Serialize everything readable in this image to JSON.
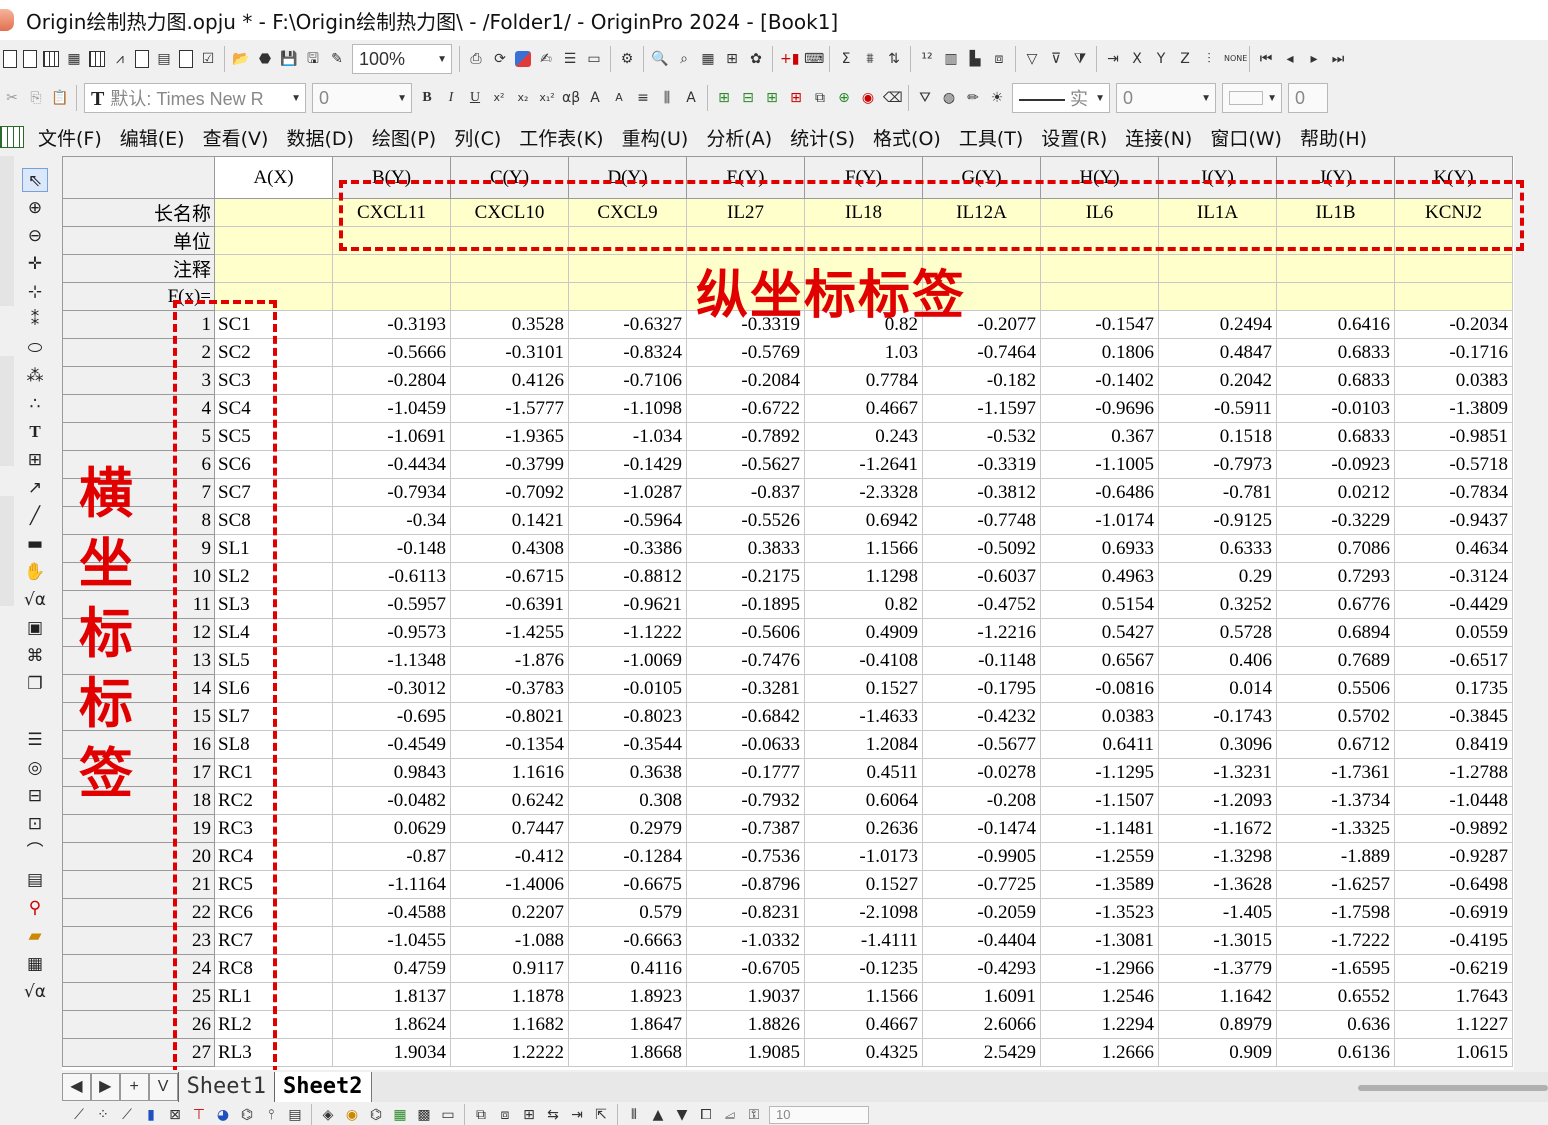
{
  "window": {
    "title": "Origin绘制热力图.opju * - F:\\Origin绘制热力图\\ - /Folder1/ - OriginPro 2024 - [Book1]"
  },
  "toolbar": {
    "zoom_value": "100%",
    "font_name": "默认: Times New R",
    "font_size": "0",
    "line_style": "实",
    "line_width": "0",
    "fill_value": "0",
    "bottom_font_size": "10"
  },
  "menu": {
    "items": [
      "文件(F)",
      "编辑(E)",
      "查看(V)",
      "数据(D)",
      "绘图(P)",
      "列(C)",
      "工作表(K)",
      "重构(U)",
      "分析(A)",
      "统计(S)",
      "格式(O)",
      "工具(T)",
      "设置(R)",
      "连接(N)",
      "窗口(W)",
      "帮助(H)"
    ]
  },
  "worksheet": {
    "columns": [
      "A(X)",
      "B(Y)",
      "C(Y)",
      "D(Y)",
      "E(Y)",
      "F(Y)",
      "G(Y)",
      "H(Y)",
      "I(Y)",
      "J(Y)",
      "K(Y)"
    ],
    "meta_labels": [
      "长名称",
      "单位",
      "注释",
      "F(x)="
    ],
    "long_names": [
      "",
      "CXCL11",
      "CXCL10",
      "CXCL9",
      "IL27",
      "IL18",
      "IL12A",
      "IL6",
      "IL1A",
      "IL1B",
      "KCNJ2"
    ],
    "rows": [
      [
        "1",
        "SC1",
        "-0.3193",
        "0.3528",
        "-0.6327",
        "-0.3319",
        "0.82",
        "-0.2077",
        "-0.1547",
        "0.2494",
        "0.6416",
        "-0.2034"
      ],
      [
        "2",
        "SC2",
        "-0.5666",
        "-0.3101",
        "-0.8324",
        "-0.5769",
        "1.03",
        "-0.7464",
        "0.1806",
        "0.4847",
        "0.6833",
        "-0.1716"
      ],
      [
        "3",
        "SC3",
        "-0.2804",
        "0.4126",
        "-0.7106",
        "-0.2084",
        "0.7784",
        "-0.182",
        "-0.1402",
        "0.2042",
        "0.6833",
        "0.0383"
      ],
      [
        "4",
        "SC4",
        "-1.0459",
        "-1.5777",
        "-1.1098",
        "-0.6722",
        "0.4667",
        "-1.1597",
        "-0.9696",
        "-0.5911",
        "-0.0103",
        "-1.3809"
      ],
      [
        "5",
        "SC5",
        "-1.0691",
        "-1.9365",
        "-1.034",
        "-0.7892",
        "0.243",
        "-0.532",
        "0.367",
        "0.1518",
        "0.6833",
        "-0.9851"
      ],
      [
        "6",
        "SC6",
        "-0.4434",
        "-0.3799",
        "-0.1429",
        "-0.5627",
        "-1.2641",
        "-0.3319",
        "-1.1005",
        "-0.7973",
        "-0.0923",
        "-0.5718"
      ],
      [
        "7",
        "SC7",
        "-0.7934",
        "-0.7092",
        "-1.0287",
        "-0.837",
        "-2.3328",
        "-0.3812",
        "-0.6486",
        "-0.781",
        "0.0212",
        "-0.7834"
      ],
      [
        "8",
        "SC8",
        "-0.34",
        "0.1421",
        "-0.5964",
        "-0.5526",
        "0.6942",
        "-0.7748",
        "-1.0174",
        "-0.9125",
        "-0.3229",
        "-0.9437"
      ],
      [
        "9",
        "SL1",
        "-0.148",
        "0.4308",
        "-0.3386",
        "0.3833",
        "1.1566",
        "-0.5092",
        "0.6933",
        "0.6333",
        "0.7086",
        "0.4634"
      ],
      [
        "10",
        "SL2",
        "-0.6113",
        "-0.6715",
        "-0.8812",
        "-0.2175",
        "1.1298",
        "-0.6037",
        "0.4963",
        "0.29",
        "0.7293",
        "-0.3124"
      ],
      [
        "11",
        "SL3",
        "-0.5957",
        "-0.6391",
        "-0.9621",
        "-0.1895",
        "0.82",
        "-0.4752",
        "0.5154",
        "0.3252",
        "0.6776",
        "-0.4429"
      ],
      [
        "12",
        "SL4",
        "-0.9573",
        "-1.4255",
        "-1.1222",
        "-0.5606",
        "0.4909",
        "-1.2216",
        "0.5427",
        "0.5728",
        "0.6894",
        "0.0559"
      ],
      [
        "13",
        "SL5",
        "-1.1348",
        "-1.876",
        "-1.0069",
        "-0.7476",
        "-0.4108",
        "-0.1148",
        "0.6567",
        "0.406",
        "0.7689",
        "-0.6517"
      ],
      [
        "14",
        "SL6",
        "-0.3012",
        "-0.3783",
        "-0.0105",
        "-0.3281",
        "0.1527",
        "-0.1795",
        "-0.0816",
        "0.014",
        "0.5506",
        "0.1735"
      ],
      [
        "15",
        "SL7",
        "-0.695",
        "-0.8021",
        "-0.8023",
        "-0.6842",
        "-1.4633",
        "-0.4232",
        "0.0383",
        "-0.1743",
        "0.5702",
        "-0.3845"
      ],
      [
        "16",
        "SL8",
        "-0.4549",
        "-0.1354",
        "-0.3544",
        "-0.0633",
        "1.2084",
        "-0.5677",
        "0.6411",
        "0.3096",
        "0.6712",
        "0.8419"
      ],
      [
        "17",
        "RC1",
        "0.9843",
        "1.1616",
        "0.3638",
        "-0.1777",
        "0.4511",
        "-0.0278",
        "-1.1295",
        "-1.3231",
        "-1.7361",
        "-1.2788"
      ],
      [
        "18",
        "RC2",
        "-0.0482",
        "0.6242",
        "0.308",
        "-0.7932",
        "0.6064",
        "-0.208",
        "-1.1507",
        "-1.2093",
        "-1.3734",
        "-1.0448"
      ],
      [
        "19",
        "RC3",
        "0.0629",
        "0.7447",
        "0.2979",
        "-0.7387",
        "0.2636",
        "-0.1474",
        "-1.1481",
        "-1.1672",
        "-1.3325",
        "-0.9892"
      ],
      [
        "20",
        "RC4",
        "-0.87",
        "-0.412",
        "-0.1284",
        "-0.7536",
        "-1.0173",
        "-0.9905",
        "-1.2559",
        "-1.3298",
        "-1.889",
        "-0.9287"
      ],
      [
        "21",
        "RC5",
        "-1.1164",
        "-1.4006",
        "-0.6675",
        "-0.8796",
        "0.1527",
        "-0.7725",
        "-1.3589",
        "-1.3628",
        "-1.6257",
        "-0.6498"
      ],
      [
        "22",
        "RC6",
        "-0.4588",
        "0.2207",
        "0.579",
        "-0.8231",
        "-2.1098",
        "-0.2059",
        "-1.3523",
        "-1.405",
        "-1.7598",
        "-0.6919"
      ],
      [
        "23",
        "RC7",
        "-1.0455",
        "-1.088",
        "-0.6663",
        "-1.0332",
        "-1.4111",
        "-0.4404",
        "-1.3081",
        "-1.3015",
        "-1.7222",
        "-0.4195"
      ],
      [
        "24",
        "RC8",
        "0.4759",
        "0.9117",
        "0.4116",
        "-0.6705",
        "-0.1235",
        "-0.4293",
        "-1.2966",
        "-1.3779",
        "-1.6595",
        "-0.6219"
      ],
      [
        "25",
        "RL1",
        "1.8137",
        "1.1878",
        "1.8923",
        "1.9037",
        "1.1566",
        "1.6091",
        "1.2546",
        "1.1642",
        "0.6552",
        "1.7643"
      ],
      [
        "26",
        "RL2",
        "1.8624",
        "1.1682",
        "1.8647",
        "1.8826",
        "0.4667",
        "2.6066",
        "1.2294",
        "0.8979",
        "0.636",
        "1.1227"
      ],
      [
        "27",
        "RL3",
        "1.9034",
        "1.2222",
        "1.8668",
        "1.9085",
        "0.4325",
        "2.5429",
        "1.2666",
        "0.909",
        "0.6136",
        "1.0615"
      ]
    ]
  },
  "sheet_tabs": {
    "nav": [
      "◀",
      "▶",
      "+",
      "V"
    ],
    "tabs": [
      "Sheet1",
      "Sheet2"
    ],
    "active": "Sheet2"
  },
  "annotations": {
    "y_label": "纵坐标标签",
    "x_label": "横坐标标签",
    "color": "#e10000"
  },
  "colors": {
    "meta_row_bg": "#ffffcc",
    "header_bg": "#f0f0f0",
    "accent_red": "#e10000"
  }
}
